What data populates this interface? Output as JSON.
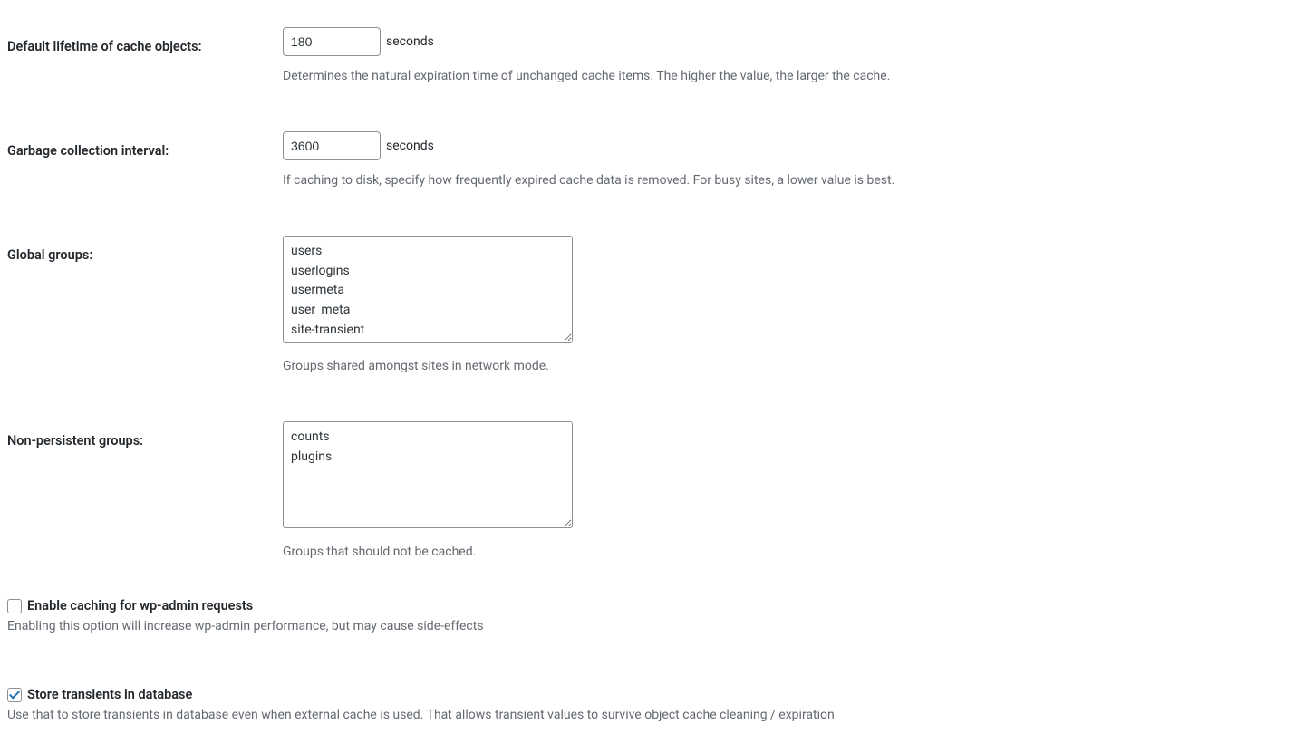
{
  "default_lifetime": {
    "label": "Default lifetime of cache objects:",
    "value": "180",
    "unit": "seconds",
    "description": "Determines the natural expiration time of unchanged cache items. The higher the value, the larger the cache."
  },
  "gc_interval": {
    "label": "Garbage collection interval:",
    "value": "3600",
    "unit": "seconds",
    "description": "If caching to disk, specify how frequently expired cache data is removed. For busy sites, a lower value is best."
  },
  "global_groups": {
    "label": "Global groups:",
    "value": "users\nuserlogins\nusermeta\nuser_meta\nsite-transient",
    "description": "Groups shared amongst sites in network mode."
  },
  "nonpersistent_groups": {
    "label": "Non-persistent groups:",
    "value": "counts\nplugins",
    "description": "Groups that should not be cached."
  },
  "wp_admin_cache": {
    "label": "Enable caching for wp-admin requests",
    "checked": false,
    "description": "Enabling this option will increase wp-admin performance, but may cause side-effects"
  },
  "store_transients": {
    "label": "Store transients in database",
    "checked": true,
    "description": "Use that to store transients in database even when external cache is used. That allows transient values to survive object cache cleaning / expiration"
  }
}
